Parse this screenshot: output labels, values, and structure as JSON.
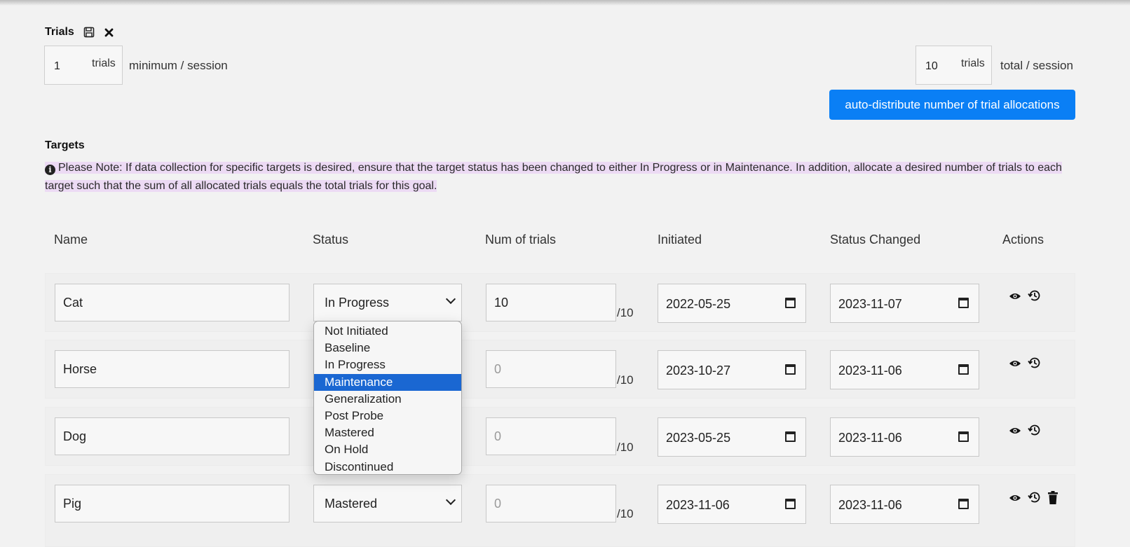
{
  "trials": {
    "title": "Trials",
    "min_value": "1",
    "min_unit": "trials",
    "min_caption": "minimum / session",
    "total_value": "10",
    "total_unit": "trials",
    "total_caption": "total / session",
    "auto_button": "auto-distribute number of trial allocations"
  },
  "targets": {
    "title": "Targets",
    "note": "Please Note: If data collection for specific targets is desired, ensure that the target status has been changed to either In Progress or in Maintenance. In addition, allocate a desired number of trials to each target such that the sum of all allocated trials equals the total trials for this goal."
  },
  "table": {
    "headers": {
      "name": "Name",
      "status": "Status",
      "num": "Num of trials",
      "initiated": "Initiated",
      "changed": "Status Changed",
      "actions": "Actions"
    },
    "rows": [
      {
        "name": "Cat",
        "status": "In Progress",
        "trials": "10",
        "denom": "/10",
        "initiated": "2022-05-25",
        "changed": "2023-11-07"
      },
      {
        "name": "Horse",
        "status": "",
        "trials": "0",
        "denom": "/10",
        "initiated": "2023-10-27",
        "changed": "2023-11-06"
      },
      {
        "name": "Dog",
        "status": "",
        "trials": "0",
        "denom": "/10",
        "initiated": "2023-05-25",
        "changed": "2023-11-06"
      },
      {
        "name": "Pig",
        "status": "Mastered",
        "trials": "0",
        "denom": "/10",
        "initiated": "2023-11-06",
        "changed": "2023-11-06"
      }
    ]
  },
  "dropdown": {
    "options": [
      "Not Initiated",
      "Baseline",
      "In Progress",
      "Maintenance",
      "Generalization",
      "Post Probe",
      "Mastered",
      "On Hold",
      "Discontinued"
    ],
    "highlighted": "Maintenance"
  },
  "colors": {
    "primary": "#0a7ff5",
    "note_highlight": "#ecdaf4",
    "selected_option": "#1a67d2"
  }
}
